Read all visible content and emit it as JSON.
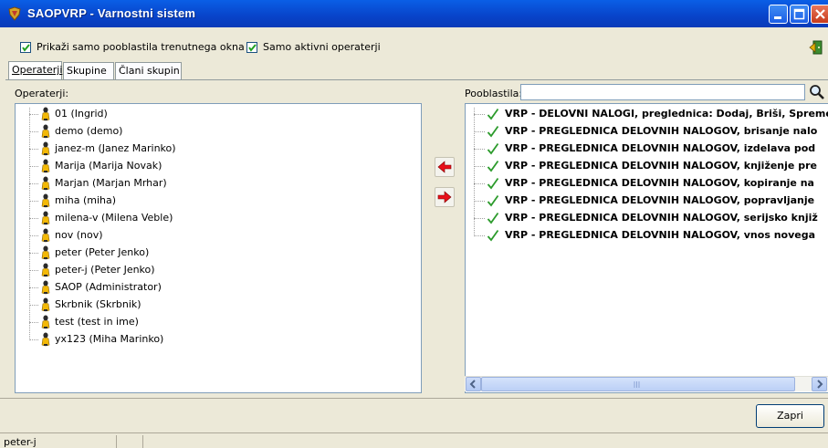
{
  "window": {
    "title": "SAOPVRP - Varnostni sistem"
  },
  "options": {
    "only_window_permissions": {
      "label": "Prikaži samo pooblastila trenutnega okna",
      "checked": true
    },
    "only_active_operators": {
      "label": "Samo aktivni operaterji",
      "checked": true
    }
  },
  "tabs": [
    {
      "label": "Operaterji",
      "active": true
    },
    {
      "label": "Skupine",
      "active": false
    },
    {
      "label": "Člani skupin",
      "active": false
    }
  ],
  "operators": {
    "label": "Operaterji:",
    "items": [
      "01 (Ingrid)",
      "demo (demo)",
      "janez-m (Janez Marinko)",
      "Marija (Marija Novak)",
      "Marjan (Marjan Mrhar)",
      "miha (miha)",
      "milena-v (Milena Veble)",
      "nov (nov)",
      "peter (Peter Jenko)",
      "peter-j (Peter Jenko)",
      "SAOP (Administrator)",
      "Skrbnik (Skrbnik)",
      "test (test in ime)",
      "yx123 (Miha Marinko)"
    ]
  },
  "permissions": {
    "label": "Pooblastila:",
    "search_value": "",
    "items": [
      "VRP - DELOVNI NALOGI, preglednica: Dodaj, Briši, Spreme",
      "VRP - PREGLEDNICA DELOVNIH NALOGOV, brisanje nalo",
      "VRP - PREGLEDNICA DELOVNIH NALOGOV, izdelava pod",
      "VRP - PREGLEDNICA DELOVNIH NALOGOV, knjiženje pre",
      "VRP - PREGLEDNICA DELOVNIH NALOGOV, kopiranje na",
      "VRP - PREGLEDNICA DELOVNIH NALOGOV, popravljanje",
      "VRP - PREGLEDNICA DELOVNIH NALOGOV, serijsko knjiž",
      "VRP - PREGLEDNICA DELOVNIH NALOGOV, vnos novega"
    ]
  },
  "buttons": {
    "close_label": "Zapri"
  },
  "status": {
    "user": "peter-j"
  },
  "colors": {
    "title_bar": "#0a5fe6",
    "check_green": "#2c9b2c",
    "arrow_red": "#e8101a"
  }
}
